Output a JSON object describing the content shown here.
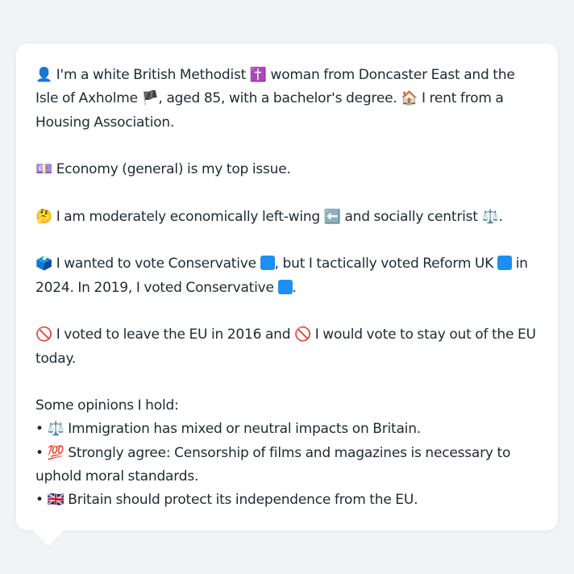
{
  "post": {
    "identity": {
      "icon": "👤",
      "t1": "I'm a white British Methodist",
      "religion_icon": "✝️",
      "t2": "woman from Doncaster East and the Isle of Axholme",
      "flag_icon": "🏴",
      "t3": ", aged 85, with a bachelor's degree.",
      "home_icon": "🏠",
      "t4": "I rent from a Housing Association."
    },
    "issue": {
      "icon": "💷",
      "text": "Economy (general) is my top issue."
    },
    "ideology": {
      "icon": "🤔",
      "t1": "I am moderately economically left-wing",
      "left_icon": "⬅️",
      "t2": "and socially centrist",
      "center_icon": "⚖️",
      "t3": "."
    },
    "vote": {
      "icon": "🗳️",
      "t1": "I wanted to vote Conservative",
      "t2": ", but I tactically voted Reform UK",
      "t3": "in 2024. In 2019, I voted Conservative",
      "t4": ".",
      "swatch_color": "#1d8ff2"
    },
    "brexit": {
      "icon": "🚫",
      "t1": "I voted to leave the EU in 2016 and",
      "icon2": "🚫",
      "t2": "I would vote to stay out of the EU today."
    },
    "opinions": {
      "heading": "Some opinions I hold:",
      "bullet": "•",
      "items": [
        {
          "icon": "⚖️",
          "text": "Immigration has mixed or neutral impacts on Britain."
        },
        {
          "icon": "💯",
          "text": "Strongly agree: Censorship of films and magazines is necessary to uphold moral standards."
        },
        {
          "icon": "🇬🇧",
          "text": "Britain should protect its independence from the EU."
        }
      ]
    }
  }
}
